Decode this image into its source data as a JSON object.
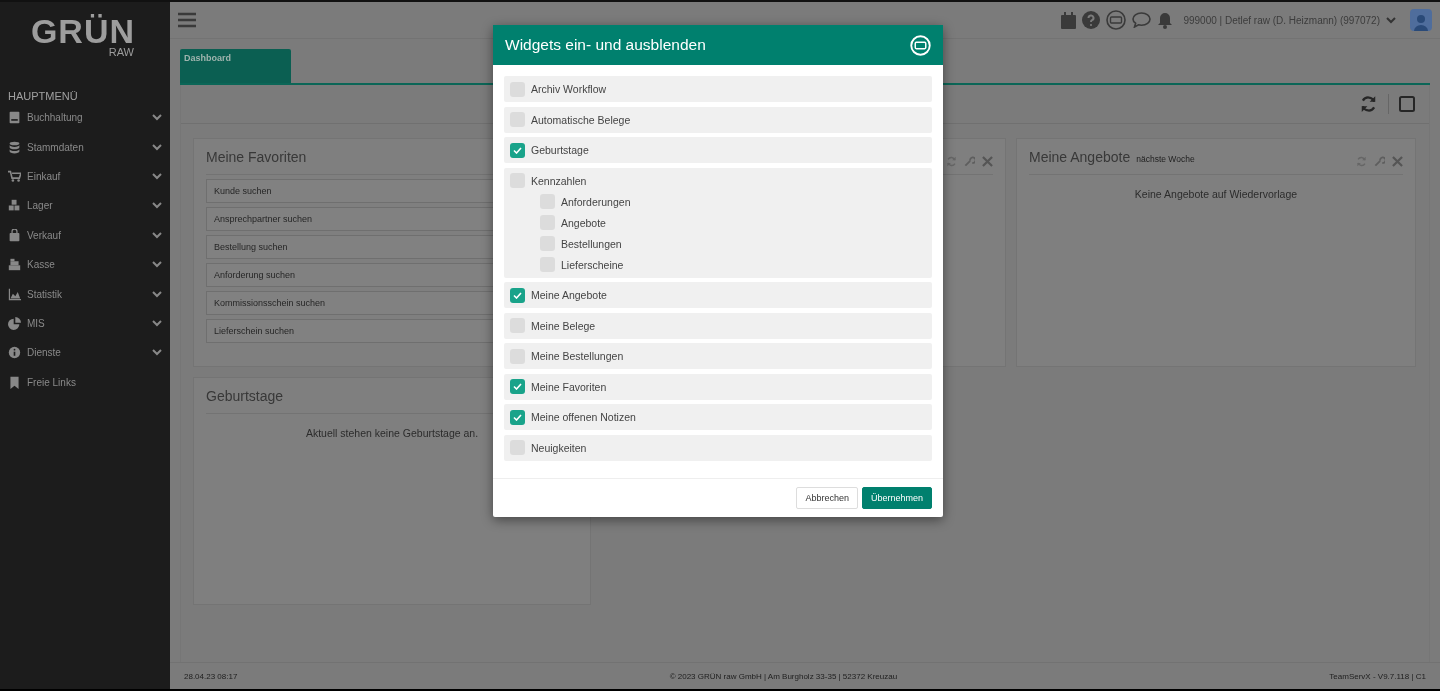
{
  "sidebar": {
    "logo": "GRÜN",
    "logo_sub": "RAW",
    "heading": "HAUPTMENÜ",
    "items": [
      {
        "label": "Buchhaltung",
        "expandable": true
      },
      {
        "label": "Stammdaten",
        "expandable": true
      },
      {
        "label": "Einkauf",
        "expandable": true
      },
      {
        "label": "Lager",
        "expandable": true
      },
      {
        "label": "Verkauf",
        "expandable": true
      },
      {
        "label": "Kasse",
        "expandable": true
      },
      {
        "label": "Statistik",
        "expandable": true
      },
      {
        "label": "MIS",
        "expandable": true
      },
      {
        "label": "Dienste",
        "expandable": true
      },
      {
        "label": "Freie Links",
        "expandable": false
      }
    ]
  },
  "header": {
    "user": "999000 | Detlef raw (D. Heizmann) (997072)"
  },
  "tabs": [
    {
      "label": "Dashboard",
      "selected": true
    }
  ],
  "widgets": [
    {
      "kind": "search-list",
      "title": "Meine Favoriten",
      "fields": [
        {
          "placeholder": "Kunde suchen"
        },
        {
          "placeholder": "Ansprechpartner suchen"
        },
        {
          "placeholder": "Bestellung suchen"
        },
        {
          "placeholder": "Anforderung suchen"
        },
        {
          "placeholder": "Kommissionsschein suchen"
        },
        {
          "placeholder": "Lieferschein suchen"
        }
      ]
    },
    {
      "kind": "message",
      "title": "Geburtstage",
      "message": "Aktuell stehen keine Geburtstage an."
    },
    {
      "kind": "message",
      "title": "Meine Angebote",
      "subtitle": "nächste Woche",
      "message": "Keine Angebote auf Wiedervorlage"
    }
  ],
  "modal": {
    "title": "Widgets ein- und ausblenden",
    "items": [
      {
        "label": "Archiv Workflow",
        "checked": false
      },
      {
        "label": "Automatische Belege",
        "checked": false
      },
      {
        "label": "Geburtstage",
        "checked": true
      },
      {
        "label": "Kennzahlen",
        "checked": false,
        "children": [
          {
            "label": "Anforderungen",
            "checked": false
          },
          {
            "label": "Angebote",
            "checked": false
          },
          {
            "label": "Bestellungen",
            "checked": false
          },
          {
            "label": "Lieferscheine",
            "checked": false
          }
        ]
      },
      {
        "label": "Meine Angebote",
        "checked": true
      },
      {
        "label": "Meine Belege",
        "checked": false
      },
      {
        "label": "Meine Bestellungen",
        "checked": false
      },
      {
        "label": "Meine Favoriten",
        "checked": true
      },
      {
        "label": "Meine offenen Notizen",
        "checked": true
      },
      {
        "label": "Neuigkeiten",
        "checked": false
      }
    ],
    "buttons": [
      {
        "label": "Abbrechen",
        "kind": "secondary"
      },
      {
        "label": "Übernehmen",
        "kind": "primary"
      }
    ]
  },
  "footer": {
    "timestamp": "28.04.23 08:17",
    "copyright": "© 2023 GRÜN raw GmbH | Am Burgholz 33-35 | 52372 Kreuzau",
    "version": "TeamServX - V9.7.118 | C1"
  }
}
